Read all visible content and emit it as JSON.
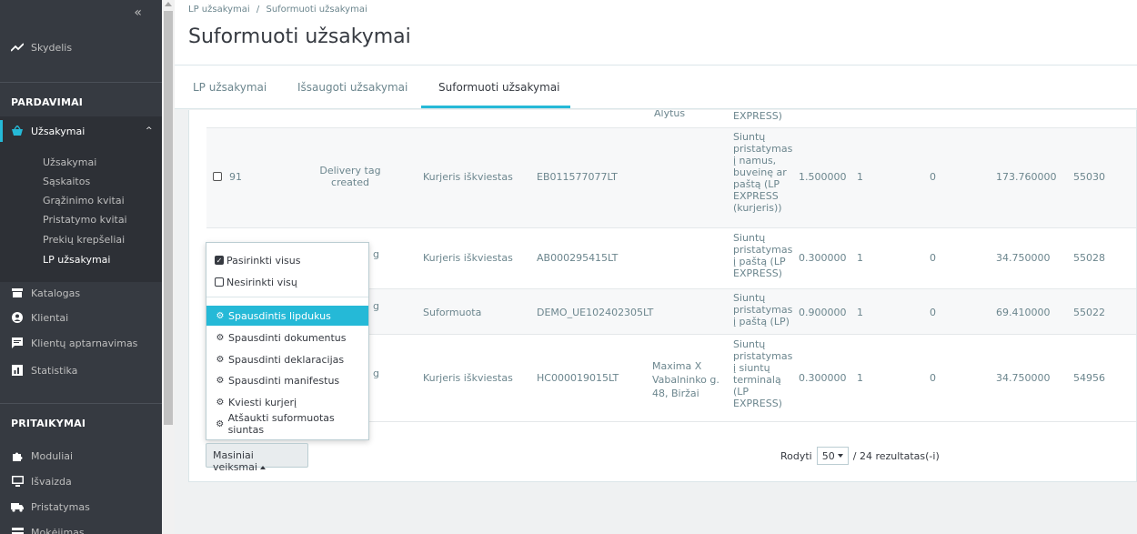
{
  "sidebar": {
    "collapse_icon": "double-chevron-left-icon",
    "dashboard": "Skydelis",
    "section_sales": "PARDAVIMAI",
    "orders": "Užsakymai",
    "sub_items": [
      "Užsakymai",
      "Sąskaitos",
      "Grąžinimo kvitai",
      "Pristatymo kvitai",
      "Prekių krepšeliai",
      "LP užsakymai"
    ],
    "catalog": "Katalogas",
    "clients": "Klientai",
    "service": "Klientų aptarnavimas",
    "stats": "Statistika",
    "section_custom": "PRITAIKYMAI",
    "modules": "Moduliai",
    "look": "Išvaizda",
    "shipping": "Pristatymas",
    "payment": "Mokėjimas"
  },
  "breadcrumb": {
    "parent": "LP užsakymai",
    "sep": "/",
    "current": "Suformuoti užsakymai"
  },
  "page_title": "Suformuoti užsakymai",
  "tabs": [
    "LP užsakymai",
    "Išsaugoti užsakymai",
    "Suformuoti užsakymai"
  ],
  "top_partial": {
    "city": "Alytus",
    "method": "EXPRESS)"
  },
  "rows": [
    {
      "id": "91",
      "status": "Delivery tag created",
      "state": "Kurjeris iškviestas",
      "tracking": "EB011577077LT",
      "address": "",
      "method": "Siuntų pristatymas į namus, buveinę ar paštą (LP EXPRESS (kurjeris))",
      "weight": "1.500000",
      "qty": "1",
      "cod": "0",
      "total": "173.760000",
      "order": "55030"
    },
    {
      "id": "",
      "status": "g",
      "state": "Kurjeris iškviestas",
      "tracking": "AB000295415LT",
      "address": "",
      "method": "Siuntų pristatymas į paštą (LP EXPRESS)",
      "weight": "0.300000",
      "qty": "1",
      "cod": "0",
      "total": "34.750000",
      "order": "55028"
    },
    {
      "id": "",
      "status": "g",
      "state": "Suformuota",
      "tracking": "DEMO_UE102402305LT",
      "address": "",
      "method": "Siuntų pristatymas į paštą (LP)",
      "weight": "0.900000",
      "qty": "1",
      "cod": "0",
      "total": "69.410000",
      "order": "55022"
    },
    {
      "id": "",
      "status": "g",
      "state": "Kurjeris iškviestas",
      "tracking": "HC000019015LT",
      "address": "Maxima X Vabalninko g. 48, Biržai",
      "method": "Siuntų pristatymas į siuntų terminalą (LP EXPRESS)",
      "weight": "0.300000",
      "qty": "1",
      "cod": "0",
      "total": "34.750000",
      "order": "54956"
    }
  ],
  "bulk_menu": {
    "select_all": "Pasirinkti visus",
    "deselect_all": "Nesirinkti visų",
    "actions": [
      "Spausdintis lipdukus",
      "Spausdinti dokumentus",
      "Spausdinti deklaracijas",
      "Spausdinti manifestus",
      "Kviesti kurjerį",
      "Atšaukti suformuotas siuntas"
    ],
    "button": "Masiniai veiksmai"
  },
  "pager": {
    "label": "Rodyti",
    "value": "50",
    "results": "/ 24 rezultatas(-i)"
  },
  "colors": {
    "accent": "#25b9d7",
    "sidebar": "#363a41"
  }
}
